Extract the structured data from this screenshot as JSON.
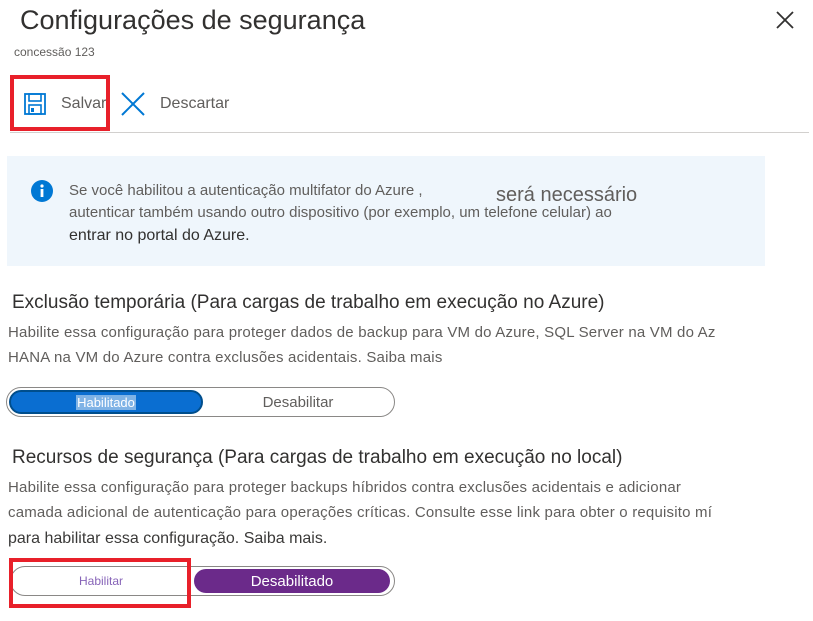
{
  "header": {
    "title": "Configurações de segurança",
    "subtitle": "concessão 123"
  },
  "toolbar": {
    "save_label": "Salvar",
    "discard_label": "Descartar"
  },
  "info": {
    "line1": "Se você habilitou a autenticação multifator do Azure ,",
    "line1_overlay": "será necessário",
    "line2": "autenticar também usando outro dispositivo (por exemplo, um telefone celular) ao",
    "line3": "entrar no portal do Azure."
  },
  "soft_delete": {
    "title": "Exclusão temporária (Para cargas de trabalho em execução no Azure)",
    "desc_line1": "Habilite essa configuração para proteger dados de backup para VM do Azure, SQL Server na VM do Az",
    "desc_line2": "HANA na VM do Azure contra exclusões acidentais. Saiba mais",
    "option_on": "Habilitado",
    "option_off": "Desabilitar",
    "selected": "Habilitado"
  },
  "security_features": {
    "title": "Recursos de segurança (Para cargas de trabalho em execução no local)",
    "desc_line1": "Habilite essa configuração para proteger backups híbridos contra exclusões acidentais e adicionar",
    "desc_line2": "camada adicional de autenticação para operações críticas. Consulte esse link para obter o requisito mí",
    "desc_line3": "para habilitar essa configuração. Saiba mais.",
    "option_on": "Habilitar",
    "option_off": "Desabilitado",
    "selected": "Desabilitado"
  },
  "colors": {
    "accent_blue": "#0a6ed1",
    "selected_purple": "#6b2a8a",
    "highlight_red": "#e8202a",
    "info_background": "#eff6fc"
  }
}
